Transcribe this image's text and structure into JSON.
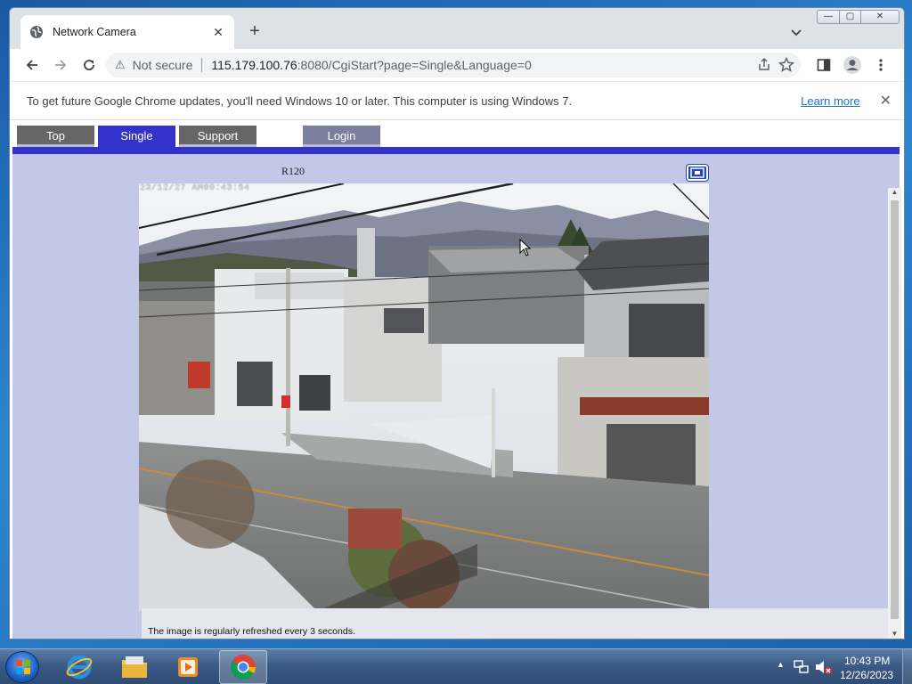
{
  "browser": {
    "tab_title": "Network Camera",
    "tab_close": "✕",
    "new_tab": "+",
    "security_label": "Not secure",
    "url_host": "115.179.100.76",
    "url_rest": ":8080/CgiStart?page=Single&Language=0",
    "window_min": "—",
    "window_max": "▢",
    "window_close": "✕"
  },
  "infobar": {
    "message": "To get future Google Chrome updates, you'll need Windows 10 or later. This computer is using Windows 7.",
    "learn_more": "Learn more",
    "close": "✕"
  },
  "camera_page": {
    "nav": {
      "top": "Top",
      "single": "Single",
      "support": "Support",
      "login": "Login"
    },
    "camera_title": "R120",
    "timestamp": "23/12/27 AM09:43:54",
    "refresh_note": "The image is regularly refreshed every 3 seconds."
  },
  "taskbar": {
    "time": "10:43 PM",
    "date": "12/26/2023"
  },
  "colors": {
    "nav_active": "#3333cc",
    "nav_inactive": "#666666",
    "content_bg": "#c4c8e8",
    "link": "#1a73e8"
  },
  "icons": {
    "tab_favicon": "globe-icon",
    "back": "arrow-left-icon",
    "forward": "arrow-right-icon",
    "reload": "reload-icon",
    "security": "warning-triangle-icon",
    "share": "share-icon",
    "bookmark": "star-icon",
    "sidepanel": "side-panel-icon",
    "profile": "profile-icon",
    "menu": "kebab-menu-icon"
  }
}
